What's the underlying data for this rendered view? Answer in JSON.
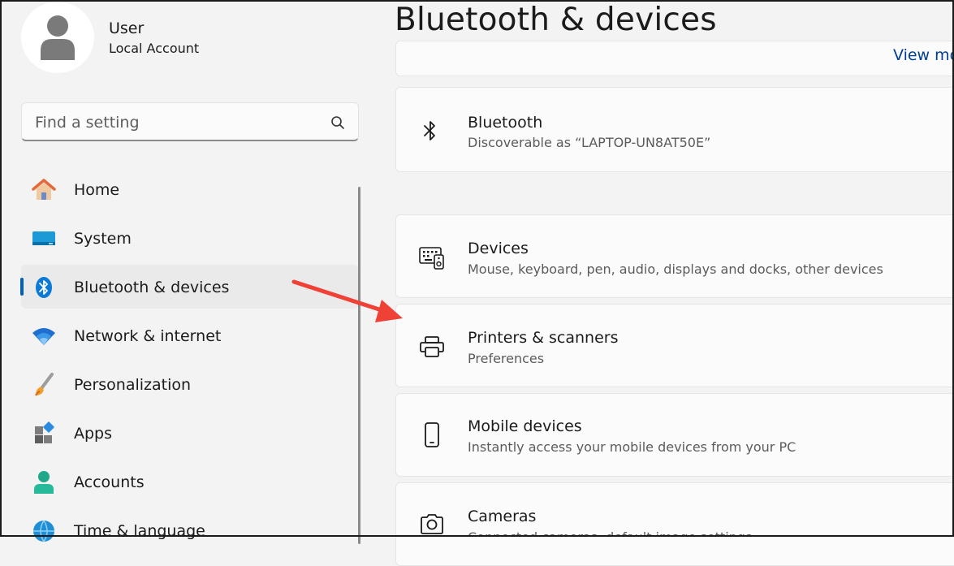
{
  "user": {
    "name": "User",
    "account": "Local Account"
  },
  "search": {
    "placeholder": "Find a setting"
  },
  "nav": [
    {
      "id": "home",
      "label": "Home",
      "icon": "home-icon"
    },
    {
      "id": "system",
      "label": "System",
      "icon": "monitor-icon"
    },
    {
      "id": "bluetooth",
      "label": "Bluetooth & devices",
      "icon": "bluetooth-icon",
      "active": true
    },
    {
      "id": "network",
      "label": "Network & internet",
      "icon": "wifi-icon"
    },
    {
      "id": "personalization",
      "label": "Personalization",
      "icon": "brush-icon"
    },
    {
      "id": "apps",
      "label": "Apps",
      "icon": "apps-icon"
    },
    {
      "id": "accounts",
      "label": "Accounts",
      "icon": "person-icon"
    },
    {
      "id": "time",
      "label": "Time & language",
      "icon": "globe-icon"
    }
  ],
  "page": {
    "title": "Bluetooth & devices"
  },
  "top_card": {
    "link": "View mo"
  },
  "cards": [
    {
      "id": "bluetooth",
      "title": "Bluetooth",
      "subtitle": "Discoverable as “LAPTOP-UN8AT50E”",
      "icon": "bluetooth-icon"
    },
    {
      "id": "devices",
      "title": "Devices",
      "subtitle": "Mouse, keyboard, pen, audio, displays and docks, other devices",
      "icon": "devices-icon"
    },
    {
      "id": "printers",
      "title": "Printers & scanners",
      "subtitle": "Preferences",
      "icon": "printer-icon"
    },
    {
      "id": "mobile",
      "title": "Mobile devices",
      "subtitle": "Instantly access your mobile devices from your PC",
      "icon": "phone-icon"
    },
    {
      "id": "cameras",
      "title": "Cameras",
      "subtitle": "Connected cameras, default image settings",
      "icon": "camera-icon"
    }
  ],
  "colors": {
    "accent": "#005fb8",
    "annotation_arrow": "#ef4136"
  }
}
